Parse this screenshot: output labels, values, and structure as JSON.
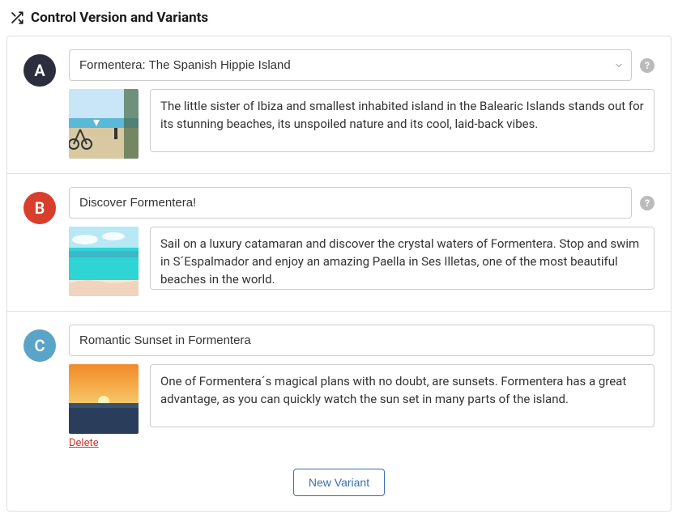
{
  "header": {
    "title": "Control Version and Variants"
  },
  "variants": {
    "A": {
      "letter": "A",
      "badge_color": "#2c2e3e",
      "title": "Formentera: The Spanish Hippie Island",
      "description": "The little sister of Ibiza and smallest inhabited island in the Balearic Islands stands out for its stunning beaches, its unspoiled nature and its cool, laid-back vibes.",
      "has_dropdown": true,
      "has_help": true,
      "image": "beach-bike"
    },
    "B": {
      "letter": "B",
      "badge_color": "#d73e2b",
      "title": "Discover Formentera!",
      "description": "Sail on a luxury catamaran and discover the crystal waters of Formentera. Stop and swim in S´Espalmador and enjoy an amazing Paella in Ses Illetas, one of the most beautiful beaches in the world.",
      "has_dropdown": false,
      "has_help": true,
      "image": "beach-turquoise"
    },
    "C": {
      "letter": "C",
      "badge_color": "#5aa3c9",
      "title": "Romantic Sunset in Formentera",
      "description": "One of Formentera´s magical plans with no doubt, are sunsets. Formentera has a great advantage, as you can quickly watch the sun set in many parts of the island.",
      "has_dropdown": false,
      "has_help": false,
      "has_delete": true,
      "delete_label": "Delete",
      "image": "sunset"
    }
  },
  "footer": {
    "new_variant_label": "New Variant"
  },
  "help_glyph": "?"
}
